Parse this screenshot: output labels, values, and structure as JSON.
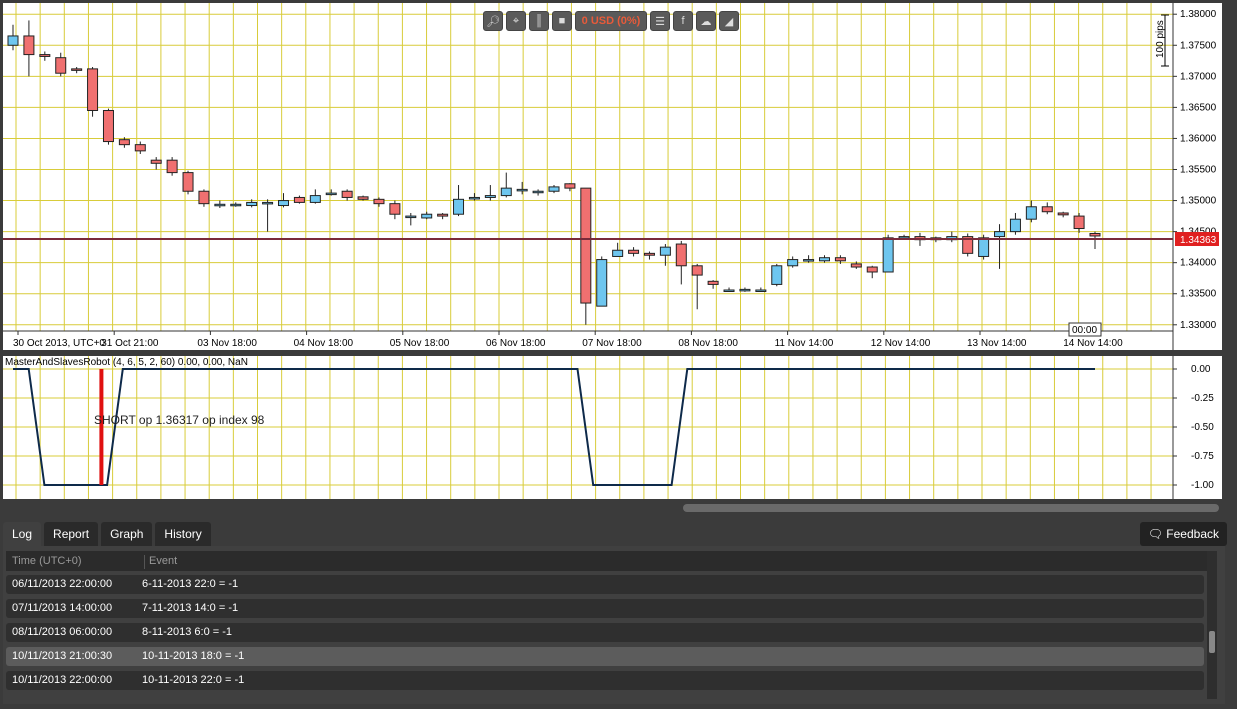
{
  "toolbar": {
    "balance": "0 USD (0%)",
    "buttons": [
      "zoom-icon",
      "crosshair-icon",
      "candles-icon",
      "square-icon",
      "list-icon",
      "facebook-icon",
      "cloud-icon",
      "chart-icon"
    ]
  },
  "chart_data": [
    {
      "type": "candlestick",
      "title": "",
      "price_marker": "1.34363",
      "ruler_label": "100 pips",
      "time_marker": "00:00",
      "y_ticks": [
        "1.38000",
        "1.37500",
        "1.37000",
        "1.36500",
        "1.36000",
        "1.35500",
        "1.35000",
        "1.34500",
        "1.34000",
        "1.33500",
        "1.33000"
      ],
      "x_labels": [
        "30 Oct 2013, UTC+0",
        "31 Oct 21:00",
        "03 Nov 18:00",
        "04 Nov 18:00",
        "05 Nov 18:00",
        "06 Nov 18:00",
        "07 Nov 18:00",
        "08 Nov 18:00",
        "11 Nov 14:00",
        "12 Nov 14:00",
        "13 Nov 14:00",
        "14 Nov 14:00"
      ],
      "ylim": [
        1.329,
        1.381
      ],
      "candles": [
        [
          1.375,
          1.3765,
          1.3783,
          1.3742
        ],
        [
          1.3765,
          1.3735,
          1.379,
          1.37
        ],
        [
          1.3735,
          1.3732,
          1.374,
          1.3725
        ],
        [
          1.373,
          1.3705,
          1.3738,
          1.37
        ],
        [
          1.3712,
          1.371,
          1.3715,
          1.3705
        ],
        [
          1.3712,
          1.3645,
          1.3715,
          1.3635
        ],
        [
          1.3645,
          1.3595,
          1.3648,
          1.359
        ],
        [
          1.3598,
          1.359,
          1.3602,
          1.3585
        ],
        [
          1.359,
          1.358,
          1.3595,
          1.3575
        ],
        [
          1.3565,
          1.356,
          1.357,
          1.355
        ],
        [
          1.3565,
          1.3545,
          1.357,
          1.354
        ],
        [
          1.3545,
          1.3515,
          1.3548,
          1.351
        ],
        [
          1.3515,
          1.3495,
          1.3518,
          1.349
        ],
        [
          1.3494,
          1.3494,
          1.35,
          1.3488
        ],
        [
          1.3494,
          1.3494,
          1.3497,
          1.349
        ],
        [
          1.3492,
          1.3497,
          1.3502,
          1.3489
        ],
        [
          1.3497,
          1.3497,
          1.3502,
          1.345
        ],
        [
          1.3492,
          1.35,
          1.3512,
          1.3489
        ],
        [
          1.3505,
          1.3497,
          1.3508,
          1.3495
        ],
        [
          1.3497,
          1.3508,
          1.3518,
          1.3495
        ],
        [
          1.3512,
          1.3512,
          1.3518,
          1.3508
        ],
        [
          1.3515,
          1.3505,
          1.3518,
          1.35
        ],
        [
          1.3506,
          1.3502,
          1.3508,
          1.35
        ],
        [
          1.3502,
          1.3495,
          1.3505,
          1.349
        ],
        [
          1.3495,
          1.3478,
          1.35,
          1.347
        ],
        [
          1.3475,
          1.3475,
          1.348,
          1.346
        ],
        [
          1.3472,
          1.3478,
          1.3482,
          1.347
        ],
        [
          1.3478,
          1.3475,
          1.348,
          1.347
        ],
        [
          1.3478,
          1.3502,
          1.3525,
          1.3475
        ],
        [
          1.3505,
          1.3505,
          1.3512,
          1.35
        ],
        [
          1.3505,
          1.3508,
          1.3525,
          1.35
        ],
        [
          1.3508,
          1.352,
          1.3545,
          1.3505
        ],
        [
          1.3518,
          1.3518,
          1.353,
          1.351
        ],
        [
          1.3515,
          1.3515,
          1.3518,
          1.3508
        ],
        [
          1.3515,
          1.3522,
          1.3525,
          1.3512
        ],
        [
          1.3527,
          1.352,
          1.3528,
          1.3515
        ],
        [
          1.352,
          1.3335,
          1.352,
          1.33
        ],
        [
          1.333,
          1.3405,
          1.341,
          1.333
        ],
        [
          1.341,
          1.342,
          1.3432,
          1.341
        ],
        [
          1.342,
          1.3415,
          1.3425,
          1.341
        ],
        [
          1.3415,
          1.3412,
          1.3418,
          1.3405
        ],
        [
          1.3412,
          1.3425,
          1.343,
          1.3395
        ],
        [
          1.343,
          1.3395,
          1.3435,
          1.3365
        ],
        [
          1.3395,
          1.338,
          1.3398,
          1.3325
        ],
        [
          1.337,
          1.3365,
          1.3372,
          1.3358
        ],
        [
          1.3356,
          1.3356,
          1.336,
          1.3353
        ],
        [
          1.3357,
          1.3357,
          1.336,
          1.3353
        ],
        [
          1.3356,
          1.3356,
          1.336,
          1.3355
        ],
        [
          1.3365,
          1.3395,
          1.3398,
          1.3362
        ],
        [
          1.3395,
          1.3405,
          1.341,
          1.3392
        ],
        [
          1.3405,
          1.3405,
          1.3412,
          1.34
        ],
        [
          1.3403,
          1.3408,
          1.3412,
          1.34
        ],
        [
          1.3408,
          1.3403,
          1.3412,
          1.3398
        ],
        [
          1.3398,
          1.3393,
          1.3402,
          1.339
        ],
        [
          1.3393,
          1.3385,
          1.3395,
          1.3375
        ],
        [
          1.3385,
          1.344,
          1.3445,
          1.3385
        ],
        [
          1.3442,
          1.3442,
          1.3445,
          1.3437
        ],
        [
          1.3442,
          1.3437,
          1.3448,
          1.3427
        ],
        [
          1.344,
          1.3437,
          1.3442,
          1.3433
        ],
        [
          1.3437,
          1.3442,
          1.345,
          1.3433
        ],
        [
          1.3442,
          1.3415,
          1.3447,
          1.341
        ],
        [
          1.341,
          1.344,
          1.3445,
          1.3405
        ],
        [
          1.3442,
          1.345,
          1.3462,
          1.339
        ],
        [
          1.345,
          1.347,
          1.348,
          1.3445
        ],
        [
          1.347,
          1.349,
          1.35,
          1.3465
        ],
        [
          1.349,
          1.3482,
          1.3497,
          1.3478
        ],
        [
          1.348,
          1.3477,
          1.3482,
          1.3473
        ],
        [
          1.3475,
          1.3455,
          1.348,
          1.3448
        ],
        [
          1.3447,
          1.3443,
          1.345,
          1.3422
        ]
      ]
    },
    {
      "type": "line",
      "indicator_label": "MasterAndSlavesRobot (4, 6, 5, 2, 60) 0.00, 0.00, NaN",
      "annotation": "SHORT op 1.36317 op index 98",
      "y_ticks": [
        "0.00",
        "-0.25",
        "-0.50",
        "-0.75",
        "-1.00"
      ],
      "ylim": [
        -1.05,
        0.05
      ],
      "values": [
        0,
        0,
        -1,
        -1,
        -1,
        -1,
        -1,
        0,
        0,
        0,
        0,
        0,
        0,
        0,
        0,
        0,
        0,
        0,
        0,
        0,
        0,
        0,
        0,
        0,
        0,
        0,
        0,
        0,
        0,
        0,
        0,
        0,
        0,
        0,
        0,
        0,
        0,
        -1,
        -1,
        -1,
        -1,
        -1,
        -1,
        0,
        0,
        0,
        0,
        0,
        0,
        0,
        0,
        0,
        0,
        0,
        0,
        0,
        0,
        0,
        0,
        0,
        0,
        0,
        0,
        0,
        0,
        0,
        0,
        0,
        0,
        0
      ],
      "signal_index": 5
    }
  ],
  "tabs": [
    {
      "label": "Log",
      "active": true
    },
    {
      "label": "Report",
      "active": false
    },
    {
      "label": "Graph",
      "active": false
    },
    {
      "label": "History",
      "active": false
    }
  ],
  "feedback_label": "Feedback",
  "log": {
    "headers": {
      "time": "Time (UTC+0)",
      "event": "Event"
    },
    "rows": [
      {
        "time": "06/11/2013 22:00:00",
        "event": "6-11-2013 22:0 = -1",
        "selected": false
      },
      {
        "time": "07/11/2013 14:00:00",
        "event": "7-11-2013 14:0 = -1",
        "selected": false
      },
      {
        "time": "08/11/2013 06:00:00",
        "event": "8-11-2013 6:0 = -1",
        "selected": false
      },
      {
        "time": "10/11/2013 21:00:30",
        "event": "10-11-2013 18:0 = -1",
        "selected": true
      },
      {
        "time": "10/11/2013 22:00:00",
        "event": "10-11-2013 22:0 = -1",
        "selected": false
      }
    ]
  }
}
